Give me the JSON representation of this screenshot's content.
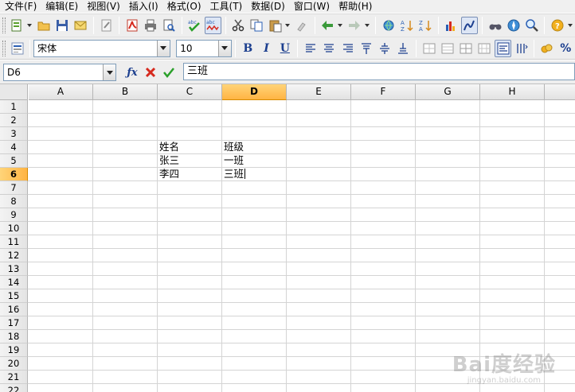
{
  "menu": [
    "文件(F)",
    "编辑(E)",
    "视图(V)",
    "插入(I)",
    "格式(O)",
    "工具(T)",
    "数据(D)",
    "窗口(W)",
    "帮助(H)"
  ],
  "font": {
    "name": "宋体",
    "size": "10"
  },
  "namebox": "D6",
  "formula": "三班",
  "columns": [
    "A",
    "B",
    "C",
    "D",
    "E",
    "F",
    "G",
    "H"
  ],
  "active_column": "D",
  "rows": [
    "1",
    "2",
    "3",
    "4",
    "5",
    "6",
    "7",
    "8",
    "9",
    "10",
    "11",
    "12",
    "13",
    "14",
    "15",
    "16",
    "17",
    "18",
    "19",
    "20",
    "21",
    "22"
  ],
  "active_row": "6",
  "cells": {
    "C4": "姓名",
    "D4": "班级",
    "C5": "张三",
    "D5": "一班",
    "C6": "李四",
    "D6": "三班"
  },
  "watermark": {
    "brand": "Bai度经验",
    "sub": "jingyan.baidu.com"
  },
  "colors": {
    "accent_header": "#ffb443",
    "grid_line": "#d4d4d4"
  }
}
